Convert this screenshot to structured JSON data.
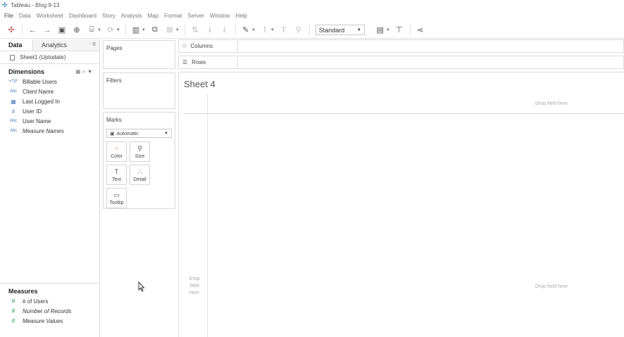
{
  "window": {
    "title": "Tableau - Blog 9-13"
  },
  "menu": [
    "File",
    "Data",
    "Worksheet",
    "Dashboard",
    "Story",
    "Analysis",
    "Map",
    "Format",
    "Server",
    "Window",
    "Help"
  ],
  "toolbar": {
    "icons": [
      "tableau-logo-icon",
      "undo-icon",
      "redo-icon",
      "save-icon",
      "new-datasource-icon",
      "datasource-icon",
      "refresh-icon",
      "new-worksheet-icon",
      "duplicate-sheet-icon",
      "clear-sheet-icon",
      "swap-icon",
      "sort-ascending-icon",
      "sort-descending-icon",
      "highlight-icon",
      "group-icon",
      "show-labels-icon",
      "pin-icon",
      "fit-icon",
      "presentation-icon",
      "share-icon"
    ],
    "fit_value": "Standard"
  },
  "data_pane": {
    "tabs": {
      "data": "Data",
      "analytics": "Analytics"
    },
    "datasource": "Sheet1 (Uptodate)",
    "dimensions_title": "Dimensions",
    "dimensions": [
      {
        "icon": "=T|F",
        "label": "Billable Users",
        "italic": false
      },
      {
        "icon": "Abc",
        "label": "Client Name",
        "italic": false
      },
      {
        "icon": "date",
        "label": "Last Logged In",
        "italic": false
      },
      {
        "icon": "#",
        "label": "User ID",
        "italic": false
      },
      {
        "icon": "Abc",
        "label": "User Name",
        "italic": false
      },
      {
        "icon": "Abc",
        "label": "Measure Names",
        "italic": true
      }
    ],
    "measures_title": "Measures",
    "measures": [
      {
        "icon": "#",
        "label": "# of Users",
        "italic": false
      },
      {
        "icon": "#",
        "label": "Number of Records",
        "italic": true
      },
      {
        "icon": "#",
        "label": "Measure Values",
        "italic": true
      }
    ]
  },
  "cards": {
    "pages": "Pages",
    "filters": "Filters",
    "marks": "Marks",
    "mark_type": "Automatic",
    "mark_buttons": {
      "color": "Color",
      "size": "Size",
      "text": "Text",
      "detail": "Detail",
      "tooltip": "Tooltip"
    }
  },
  "shelves": {
    "columns": "Columns",
    "rows": "Rows"
  },
  "view": {
    "sheet_title": "Sheet 4",
    "drop_top": "Drop field here",
    "drop_left_1": "Drop",
    "drop_left_2": "field",
    "drop_left_3": "here",
    "drop_right": "Drop field here"
  }
}
